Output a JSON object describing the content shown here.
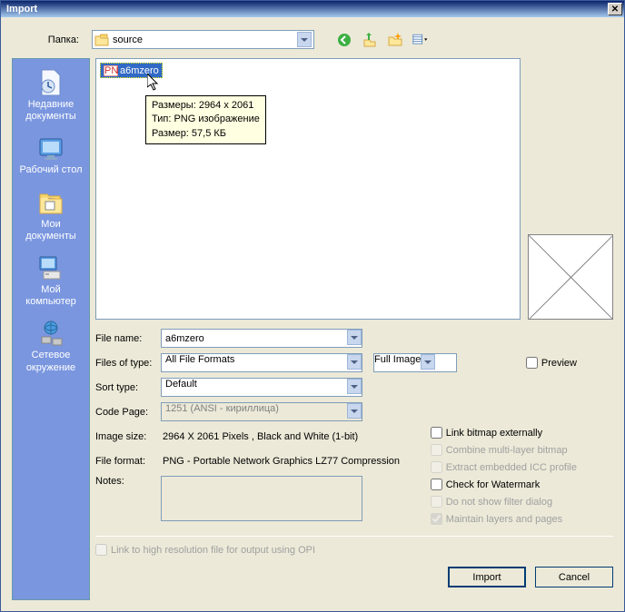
{
  "titlebar": {
    "title": "Import"
  },
  "top": {
    "folder_label": "Папка:",
    "folder_value": "source"
  },
  "places": {
    "recent": "Недавние документы",
    "desktop": "Рабочий стол",
    "mydocs": "Мои документы",
    "mycomp": "Мой компьютер",
    "network": "Сетевое окружение"
  },
  "file": {
    "selected_name": "a6mzero",
    "tooltip_dims": "Размеры: 2964 x 2061",
    "tooltip_type": "Тип: PNG изображение",
    "tooltip_size": "Размер: 57,5 КБ"
  },
  "form": {
    "filename_label": "File name:",
    "filename_value": "a6mzero",
    "filetype_label": "Files of type:",
    "filetype_value": "All File Formats",
    "fullimage": "Full Image",
    "preview_label": "Preview",
    "sort_label": "Sort type:",
    "sort_value": "Default",
    "codepage_label": "Code Page:",
    "codepage_value": "1251 (ANSI - кириллица)",
    "imagesize_label": "Image size:",
    "imagesize_value": "2964 X 2061 Pixels , Black and White (1-bit)",
    "fileformat_label": "File format:",
    "fileformat_value": "PNG - Portable Network Graphics LZ77 Compression",
    "notes_label": "Notes:"
  },
  "checks": {
    "link_bitmap": "Link bitmap externally",
    "combine": "Combine multi-layer bitmap",
    "extract_icc": "Extract embedded ICC profile",
    "watermark": "Check for Watermark",
    "no_filter": "Do not show filter dialog",
    "maintain": "Maintain layers and pages",
    "opi": "Link to high resolution file for output using OPI"
  },
  "buttons": {
    "import": "Import",
    "cancel": "Cancel"
  }
}
